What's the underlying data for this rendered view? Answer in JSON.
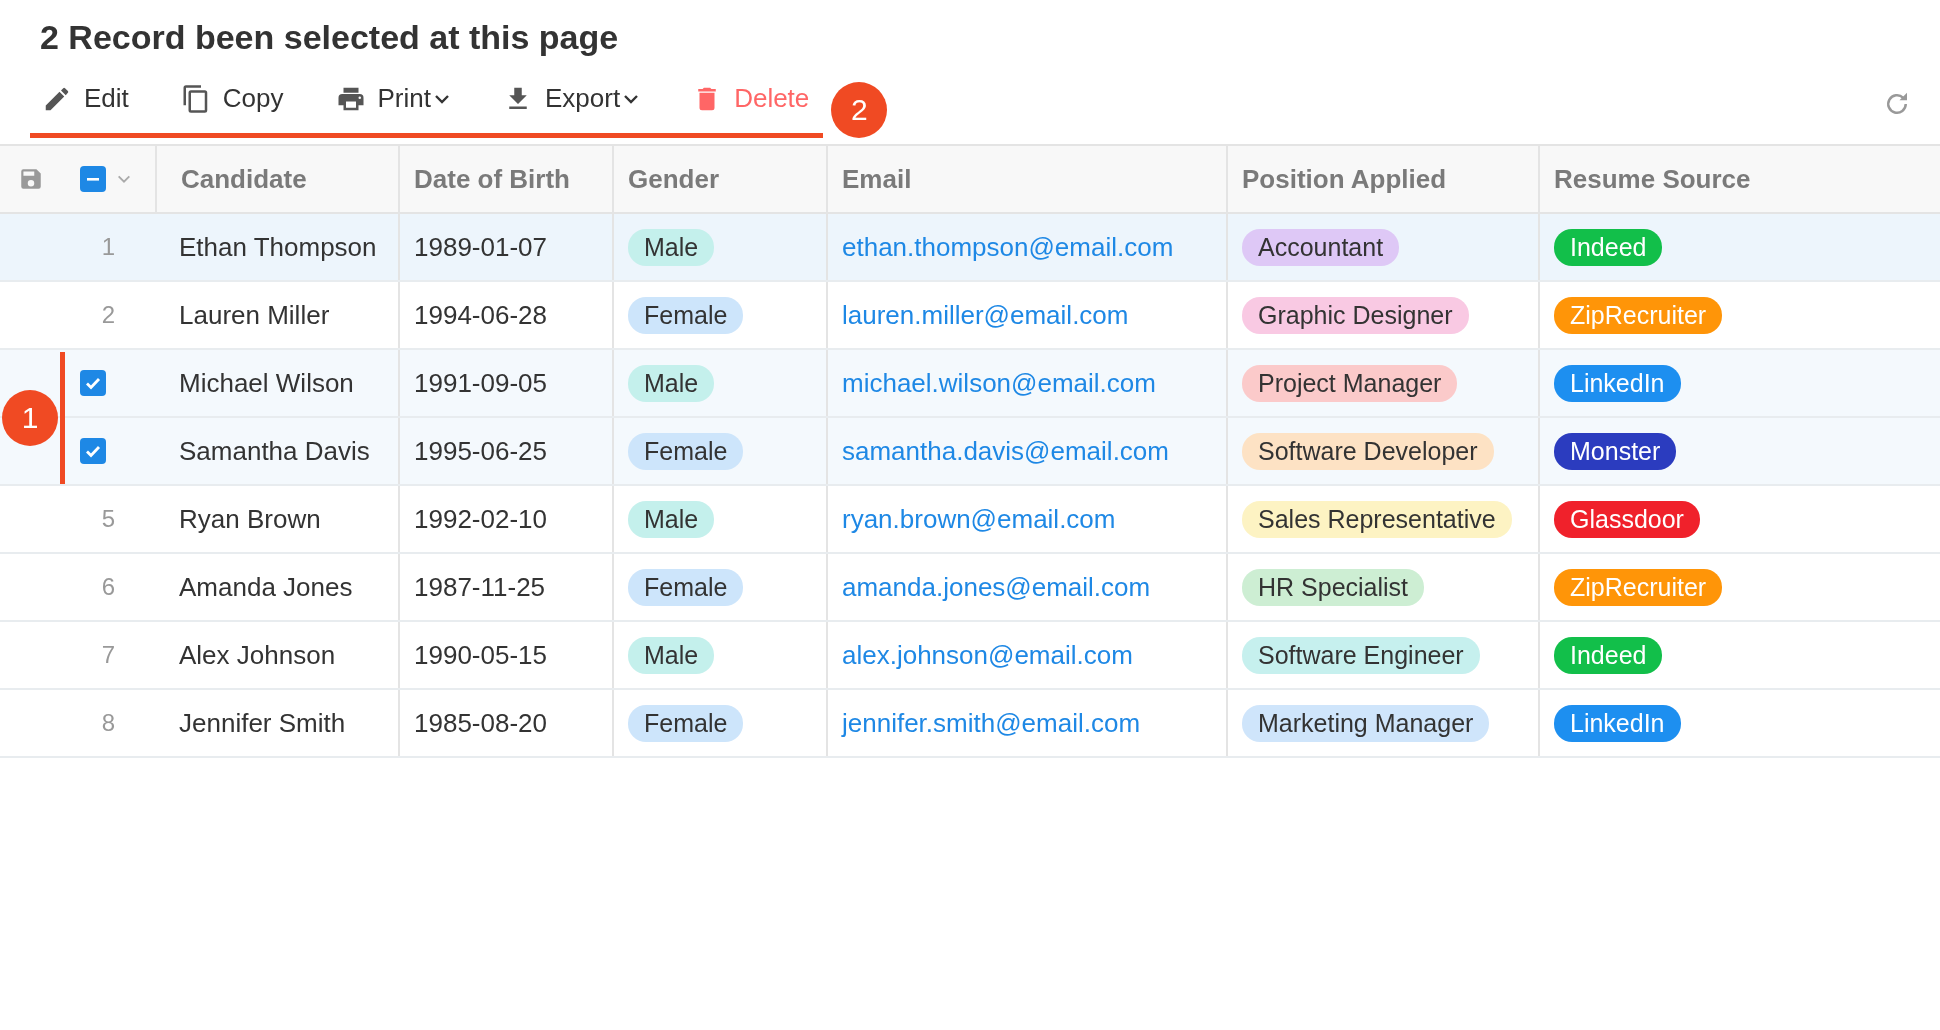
{
  "heading": "2 Record been selected at this page",
  "toolbar": {
    "callout": "2",
    "items": [
      {
        "kind": "edit",
        "label": "Edit",
        "dropdown": false,
        "danger": false
      },
      {
        "kind": "copy",
        "label": "Copy",
        "dropdown": false,
        "danger": false
      },
      {
        "kind": "print",
        "label": "Print",
        "dropdown": true,
        "danger": false
      },
      {
        "kind": "export",
        "label": "Export",
        "dropdown": true,
        "danger": false
      },
      {
        "kind": "delete",
        "label": "Delete",
        "dropdown": false,
        "danger": true
      }
    ]
  },
  "table": {
    "callout": "1",
    "select_all": {
      "partial": true
    },
    "columns": [
      "Candidate",
      "Date of Birth",
      "Gender",
      "Email",
      "Position Applied",
      "Resume Source"
    ],
    "rows": [
      {
        "number": "1",
        "selected": false,
        "hovered": true,
        "candidate": "Ethan Thompson",
        "dob": "1989-01-07",
        "gender": {
          "text": "Male",
          "color": "#c4f0ec"
        },
        "email": "ethan.thompson@email.com",
        "position": {
          "text": "Accountant",
          "color": "#dec8f6"
        },
        "source": {
          "text": "Indeed",
          "color": "#12bf4a"
        }
      },
      {
        "number": "2",
        "selected": false,
        "hovered": false,
        "candidate": "Lauren Miller",
        "dob": "1994-06-28",
        "gender": {
          "text": "Female",
          "color": "#cde5fb"
        },
        "email": "lauren.miller@email.com",
        "position": {
          "text": "Graphic Designer",
          "color": "#f9c9e3"
        },
        "source": {
          "text": "ZipRecruiter",
          "color": "#ff9508"
        }
      },
      {
        "selected": true,
        "hovered": false,
        "candidate": "Michael Wilson",
        "dob": "1991-09-05",
        "gender": {
          "text": "Male",
          "color": "#c4f0ec"
        },
        "email": "michael.wilson@email.com",
        "position": {
          "text": "Project Manager",
          "color": "#fbcaca"
        },
        "source": {
          "text": "LinkedIn",
          "color": "#1d8ff0"
        }
      },
      {
        "selected": true,
        "hovered": false,
        "candidate": "Samantha Davis",
        "dob": "1995-06-25",
        "gender": {
          "text": "Female",
          "color": "#cde5fb"
        },
        "email": "samantha.davis@email.com",
        "position": {
          "text": "Software Developer",
          "color": "#fde2c4"
        },
        "source": {
          "text": "Monster",
          "color": "#2b3cbf"
        }
      },
      {
        "number": "5",
        "selected": false,
        "hovered": false,
        "candidate": "Ryan Brown",
        "dob": "1992-02-10",
        "gender": {
          "text": "Male",
          "color": "#c4f0ec"
        },
        "email": "ryan.brown@email.com",
        "position": {
          "text": "Sales Representative",
          "color": "#fdf3c3"
        },
        "source": {
          "text": "Glassdoor",
          "color": "#f0212b"
        }
      },
      {
        "number": "6",
        "selected": false,
        "hovered": false,
        "candidate": "Amanda Jones",
        "dob": "1987-11-25",
        "gender": {
          "text": "Female",
          "color": "#cde5fb"
        },
        "email": "amanda.jones@email.com",
        "position": {
          "text": "HR Specialist",
          "color": "#cdeed3"
        },
        "source": {
          "text": "ZipRecruiter",
          "color": "#ff9508"
        }
      },
      {
        "number": "7",
        "selected": false,
        "hovered": false,
        "candidate": "Alex Johnson",
        "dob": "1990-05-15",
        "gender": {
          "text": "Male",
          "color": "#c4f0ec"
        },
        "email": "alex.johnson@email.com",
        "position": {
          "text": "Software Engineer",
          "color": "#c6f0ee"
        },
        "source": {
          "text": "Indeed",
          "color": "#12bf4a"
        }
      },
      {
        "number": "8",
        "selected": false,
        "hovered": false,
        "candidate": "Jennifer Smith",
        "dob": "1985-08-20",
        "gender": {
          "text": "Female",
          "color": "#cde5fb"
        },
        "email": "jennifer.smith@email.com",
        "position": {
          "text": "Marketing Manager",
          "color": "#cfe5fb"
        },
        "source": {
          "text": "LinkedIn",
          "color": "#1d8ff0"
        }
      }
    ]
  }
}
